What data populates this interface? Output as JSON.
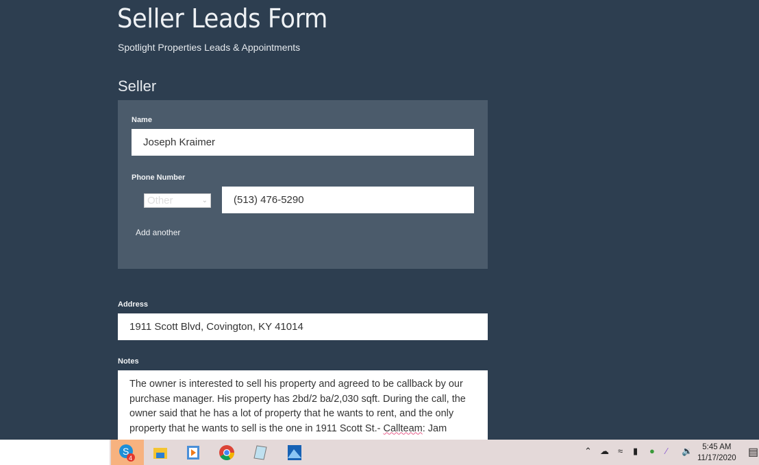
{
  "page": {
    "title": "Seller Leads Form",
    "subtitle": "Spotlight Properties Leads & Appointments"
  },
  "seller": {
    "heading": "Seller",
    "name_label": "Name",
    "name_value": "Joseph Kraimer",
    "phone_label": "Phone Number",
    "phone_type": "Other",
    "phone_value": "(513) 476-5290",
    "add_another": "Add another"
  },
  "address": {
    "label": "Address",
    "value": "1911 Scott Blvd, Covington, KY 41014"
  },
  "notes": {
    "label": "Notes",
    "value_before": "The owner is interested to sell his property and agreed to be callback by our purchase manager. His property has 2bd/2 ba/2,030 sqft. During the call, the owner said that he has a lot of property that he wants to rent, and the only property that he wants to sell is the one in 1911 Scott St.- ",
    "misspelled": "Callteam",
    "value_after": ": Jam"
  },
  "taskbar": {
    "apps": [
      {
        "icon": "skype-icon",
        "badge": "4"
      },
      {
        "icon": "file-explorer-icon"
      },
      {
        "icon": "media-player-icon"
      },
      {
        "icon": "chrome-icon"
      },
      {
        "icon": "notepad-icon"
      },
      {
        "icon": "photos-icon"
      }
    ],
    "time": "5:45 AM",
    "date": "11/17/2020"
  },
  "colors": {
    "background": "#2d3e50",
    "panel": "#4b5b6b",
    "taskbar": "#e4d9d9"
  }
}
